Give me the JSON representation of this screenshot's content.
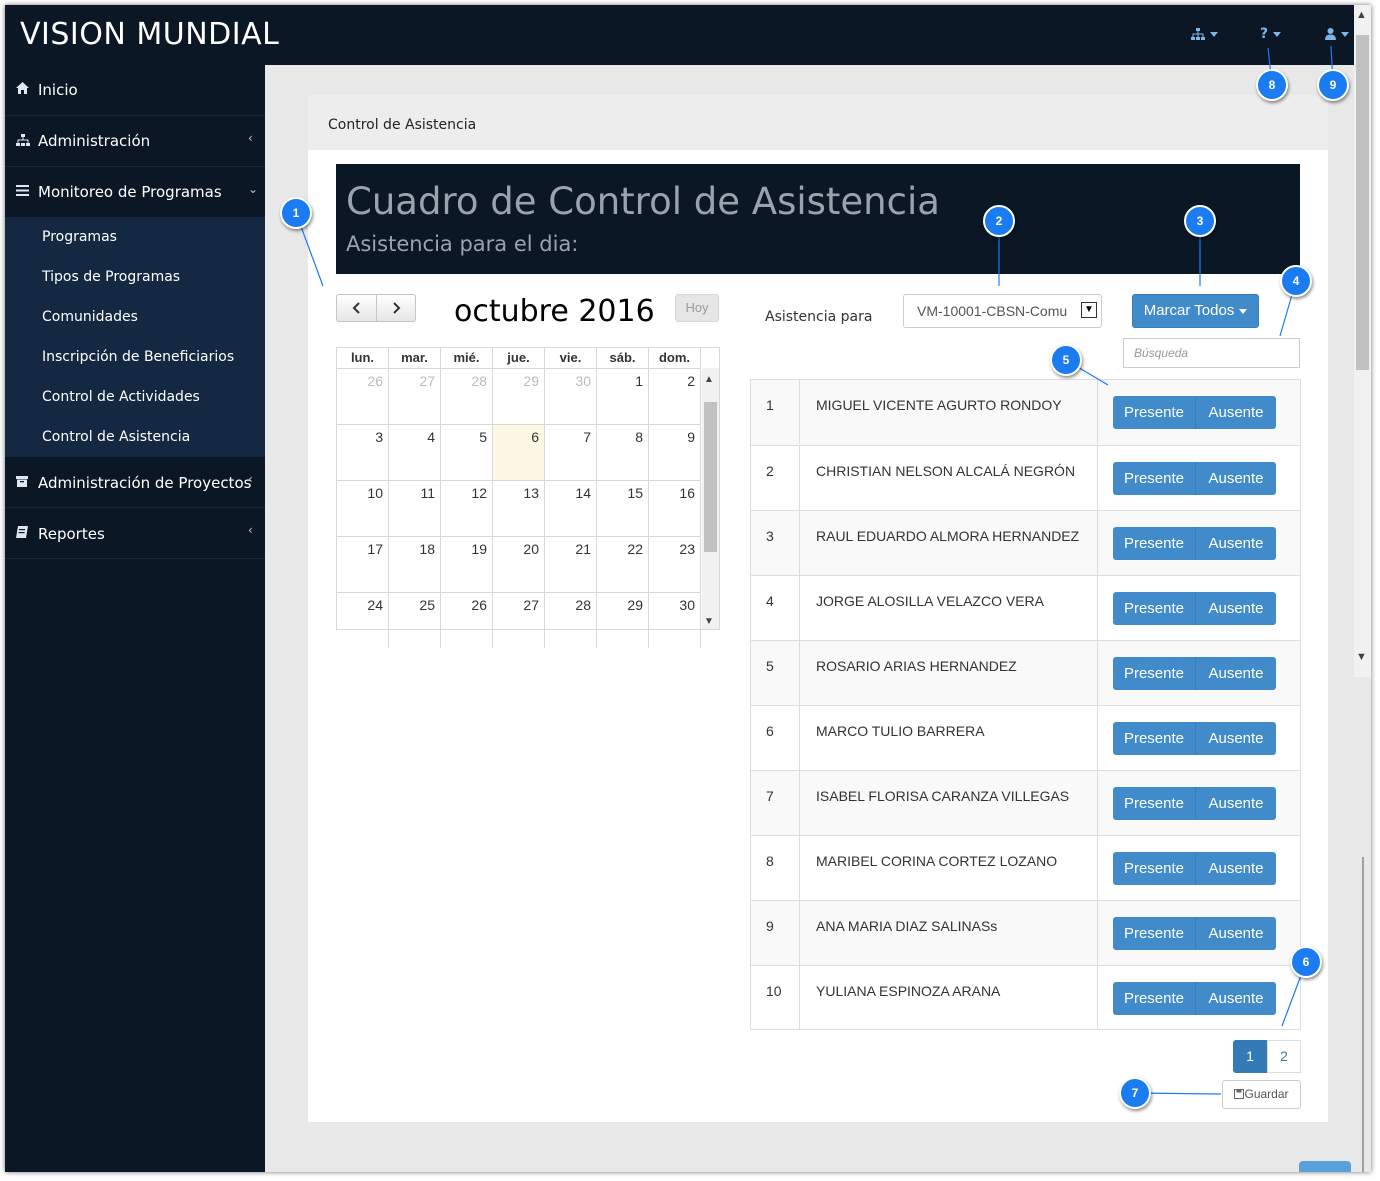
{
  "app": {
    "brand": "VISION MUNDIAL"
  },
  "topbar": {
    "icons": [
      "sitemap-icon",
      "question-icon",
      "user-icon"
    ],
    "help_glyph": "?"
  },
  "sidebar": {
    "items": [
      {
        "label": "Inicio",
        "icon": "home-icon"
      },
      {
        "label": "Administración",
        "icon": "sitemap-icon"
      },
      {
        "label": "Monitoreo de Programas",
        "icon": "bars-icon"
      },
      {
        "label": "Administración de Proyectos",
        "icon": "archive-icon"
      },
      {
        "label": "Reportes",
        "icon": "book-icon"
      }
    ],
    "submenu": [
      "Programas",
      "Tipos de Programas",
      "Comunidades",
      "Inscripción de Beneficiarios",
      "Control de Actividades",
      "Control de Asistencia"
    ]
  },
  "panel": {
    "title": "Control de Asistencia"
  },
  "hero": {
    "title": "Cuadro de Control de Asistencia",
    "subtitle": "Asistencia para el dia:"
  },
  "calendar": {
    "title": "octubre 2016",
    "today_button": "Hoy",
    "days_of_week": [
      "lun.",
      "mar.",
      "mié.",
      "jue.",
      "vie.",
      "sáb.",
      "dom."
    ],
    "weeks": [
      [
        "26",
        "27",
        "28",
        "29",
        "30",
        "1",
        "2"
      ],
      [
        "3",
        "4",
        "5",
        "6",
        "7",
        "8",
        "9"
      ],
      [
        "10",
        "11",
        "12",
        "13",
        "14",
        "15",
        "16"
      ],
      [
        "17",
        "18",
        "19",
        "20",
        "21",
        "22",
        "23"
      ],
      [
        "24",
        "25",
        "26",
        "27",
        "28",
        "29",
        "30"
      ]
    ],
    "selected_day": "6"
  },
  "attendance": {
    "label": "Asistencia para",
    "selected_value": "VM-10001-CBSN-Comu",
    "mark_all_label": "Marcar Todos",
    "search_placeholder": "Búsqueda",
    "present_label": "Presente",
    "absent_label": "Ausente",
    "rows": [
      {
        "num": "1",
        "name": "MIGUEL VICENTE AGURTO RONDOY"
      },
      {
        "num": "2",
        "name": "CHRISTIAN NELSON ALCALÁ NEGRÓN"
      },
      {
        "num": "3",
        "name": "RAUL EDUARDO ALMORA HERNANDEZ"
      },
      {
        "num": "4",
        "name": "JORGE ALOSILLA VELAZCO VERA"
      },
      {
        "num": "5",
        "name": "ROSARIO ARIAS HERNANDEZ"
      },
      {
        "num": "6",
        "name": "MARCO TULIO BARRERA"
      },
      {
        "num": "7",
        "name": "ISABEL FLORISA CARANZA VILLEGAS"
      },
      {
        "num": "8",
        "name": "MARIBEL CORINA CORTEZ LOZANO"
      },
      {
        "num": "9",
        "name": "ANA MARIA DIAZ SALINASs"
      },
      {
        "num": "10",
        "name": "YULIANA ESPINOZA ARANA"
      }
    ],
    "pages": [
      "1",
      "2"
    ],
    "save_label": "Guardar"
  },
  "markers": [
    "1",
    "2",
    "3",
    "4",
    "5",
    "6",
    "7",
    "8",
    "9"
  ]
}
